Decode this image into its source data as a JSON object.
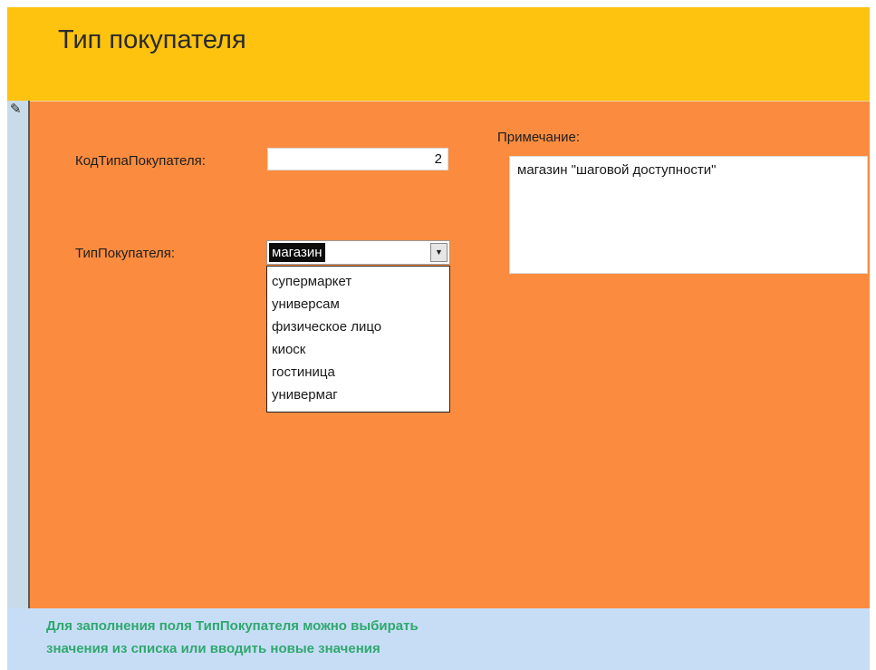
{
  "header": {
    "title": "Тип покупателя"
  },
  "record_selector": {
    "icon": "pencil-edit-icon",
    "glyph": "✎"
  },
  "form": {
    "code_label": "КодТипаПокупателя:",
    "code_value": "2",
    "type_label": "ТипПокупателя:",
    "type_value": "магазин",
    "type_options": [
      "супермаркет",
      "универсам",
      "физическое лицо",
      "киоск",
      "гостиница",
      "универмаг"
    ],
    "notes_label": "Примечание:",
    "notes_value": "магазин \"шаговой доступности\""
  },
  "status_bar": {
    "line1": "Для заполнения поля ТипПокупателя можно выбирать",
    "line2": "значения из списка или вводить новые значения"
  },
  "colors": {
    "header_bg": "#fdc30f",
    "form_bg": "#fb8c3f",
    "status_bg": "#c7ddf6",
    "status_text": "#2fa86e"
  }
}
